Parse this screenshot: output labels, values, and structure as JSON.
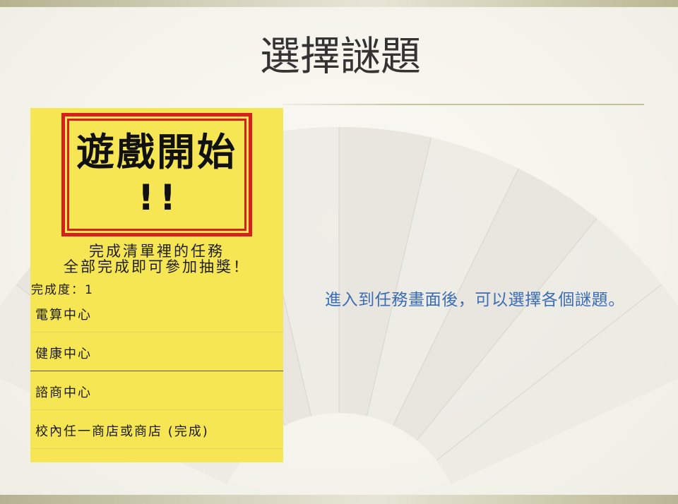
{
  "slide": {
    "title": "選擇謎題",
    "caption": "進入到任務畫面後，可以選擇各個謎題。"
  },
  "app": {
    "banner": {
      "line1": "遊戲開始",
      "line2": "!!"
    },
    "instructions": {
      "line1": "完成清單裡的任務",
      "line2": "全部完成即可參加抽獎！"
    },
    "progress": {
      "label": "完成度：",
      "value": "1"
    },
    "tasks": [
      {
        "label": "電算中心"
      },
      {
        "label": "健康中心"
      },
      {
        "label": "諮商中心"
      },
      {
        "label": "校內任一商店或商店 (完成)"
      }
    ]
  },
  "colors": {
    "panel_yellow": "#f7e654",
    "banner_red": "#d61f1f",
    "caption_blue": "#3a6db5",
    "title_text": "#333333"
  }
}
